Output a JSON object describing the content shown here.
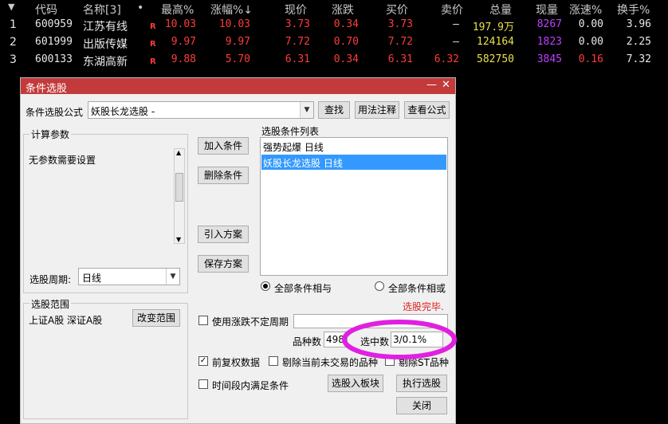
{
  "table": {
    "columns": [
      "代码",
      "名称[3]",
      "•",
      "最高%",
      "涨幅%↓",
      "现价",
      "涨跌",
      "买价",
      "卖价",
      "总量",
      "现量",
      "涨速%",
      "换手%"
    ],
    "rows": [
      {
        "idx": "1",
        "code": "600959",
        "name": "江苏有线",
        "flag": "R",
        "high": "10.03",
        "change_pct": "10.03",
        "price": "3.73",
        "change": "0.34",
        "bid": "3.73",
        "ask": "–",
        "volume": "197.9万",
        "cur_vol": "8267",
        "speed": "0.00",
        "turnover": "3.96"
      },
      {
        "idx": "2",
        "code": "601999",
        "name": "出版传媒",
        "flag": "R",
        "high": "9.97",
        "change_pct": "9.97",
        "price": "7.72",
        "change": "0.70",
        "bid": "7.72",
        "ask": "–",
        "volume": "124164",
        "cur_vol": "1823",
        "speed": "0.00",
        "turnover": "2.25"
      },
      {
        "idx": "3",
        "code": "600133",
        "name": "东湖高新",
        "flag": "R",
        "high": "9.88",
        "change_pct": "5.70",
        "price": "6.31",
        "change": "0.34",
        "bid": "6.31",
        "ask": "6.32",
        "volume": "582750",
        "cur_vol": "3845",
        "speed": "0.16",
        "turnover": "7.32"
      }
    ]
  },
  "dialog": {
    "title": "条件选股",
    "minimize": "—",
    "close": "✕",
    "formula_label": "条件选股公式",
    "formula_value": "妖股长龙选股 -",
    "btn_find": "查找",
    "btn_usage": "用法注释",
    "btn_view": "查看公式",
    "params_title": "计算参数",
    "params_text": "无参数需要设置",
    "period_label": "选股周期:",
    "period_value": "日线",
    "btn_add": "加入条件",
    "btn_delete": "删除条件",
    "btn_import": "引入方案",
    "btn_save": "保存方案",
    "cond_list_title": "选股条件列表",
    "conditions": [
      "强势起爆  日线",
      "妖股长龙选股  日线"
    ],
    "radio_and": "全部条件相与",
    "radio_or": "全部条件相或",
    "status": "选股完毕.",
    "range_title": "选股范围",
    "range_text": "上证A股 深证A股",
    "btn_change_range": "改变范围",
    "chk_uncertain_period": "使用涨跌不定周期",
    "count_label": "品种数",
    "count_value": "4984",
    "selected_label": "选中数",
    "selected_value": "3/0.1%",
    "chk_fq": "前复权数据",
    "chk_exclude_untraded": "剔除当前未交易的品种",
    "chk_exclude_st": "剔除ST品种",
    "chk_time_range": "时间段内满足条件",
    "btn_to_block": "选股入板块",
    "btn_execute": "执行选股",
    "btn_close": "关闭",
    "highlight_color": "#e020e0",
    "title_bar_color": "#c33a3a",
    "selected_item_color": "#3399ff"
  }
}
